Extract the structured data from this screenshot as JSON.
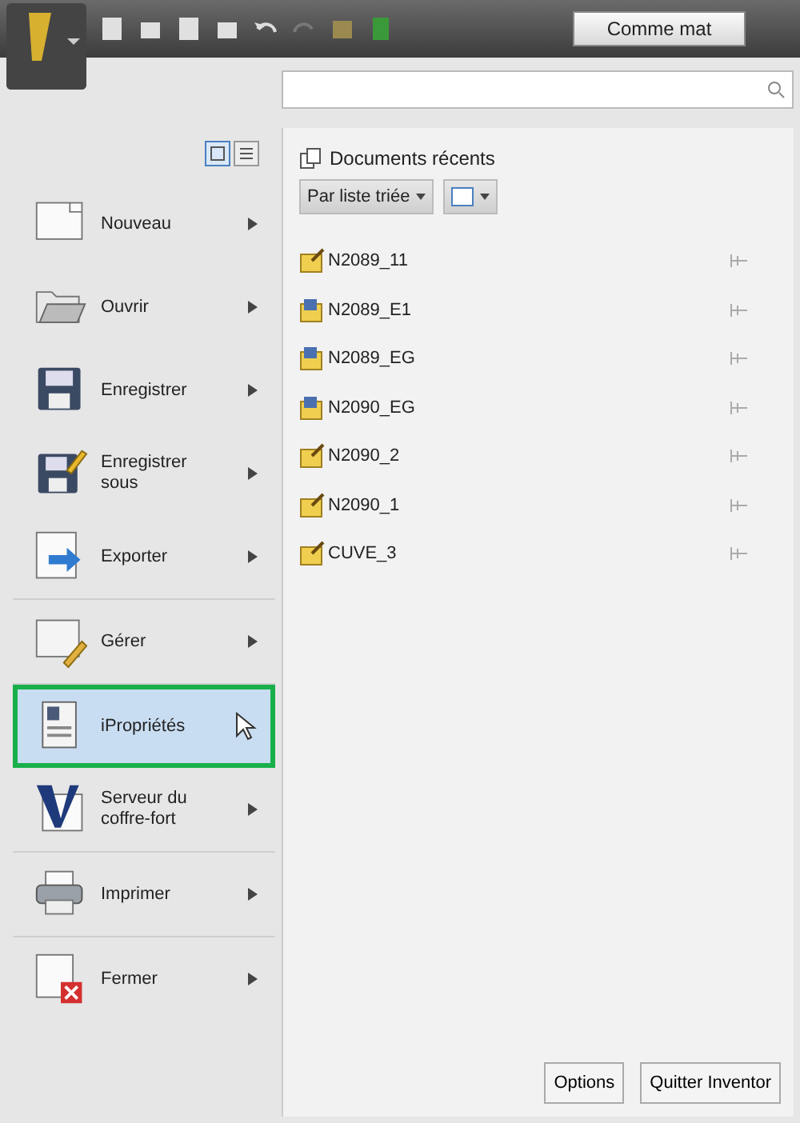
{
  "toolbar": {
    "material": "Comme mat"
  },
  "recent": {
    "title": "Documents récents",
    "sort": "Par liste triée",
    "files": [
      {
        "name": "N2089_11",
        "kind": "part"
      },
      {
        "name": "N2089_E1",
        "kind": "assembly"
      },
      {
        "name": "N2089_EG",
        "kind": "assembly"
      },
      {
        "name": "N2090_EG",
        "kind": "assembly"
      },
      {
        "name": "N2090_2",
        "kind": "part"
      },
      {
        "name": "N2090_1",
        "kind": "part"
      },
      {
        "name": "CUVE_3",
        "kind": "part"
      }
    ]
  },
  "menu_groups": [
    [
      {
        "label": "Nouveau",
        "submenu": true,
        "selected": false
      },
      {
        "label": "Ouvrir",
        "submenu": true,
        "selected": false
      },
      {
        "label": "Enregistrer",
        "submenu": true,
        "selected": false
      },
      {
        "label": "Enregistrer sous",
        "submenu": true,
        "selected": false
      },
      {
        "label": "Exporter",
        "submenu": true,
        "selected": false
      }
    ],
    [
      {
        "label": "Gérer",
        "submenu": true,
        "selected": false
      }
    ],
    [
      {
        "label": "iPropriétés",
        "submenu": false,
        "selected": true
      },
      {
        "label": "Serveur du coffre-fort",
        "submenu": true,
        "selected": false
      }
    ],
    [
      {
        "label": "Imprimer",
        "submenu": true,
        "selected": false
      }
    ],
    [
      {
        "label": "Fermer",
        "submenu": true,
        "selected": false
      }
    ]
  ],
  "buttons": [
    "Options",
    "Quitter Inventor"
  ]
}
